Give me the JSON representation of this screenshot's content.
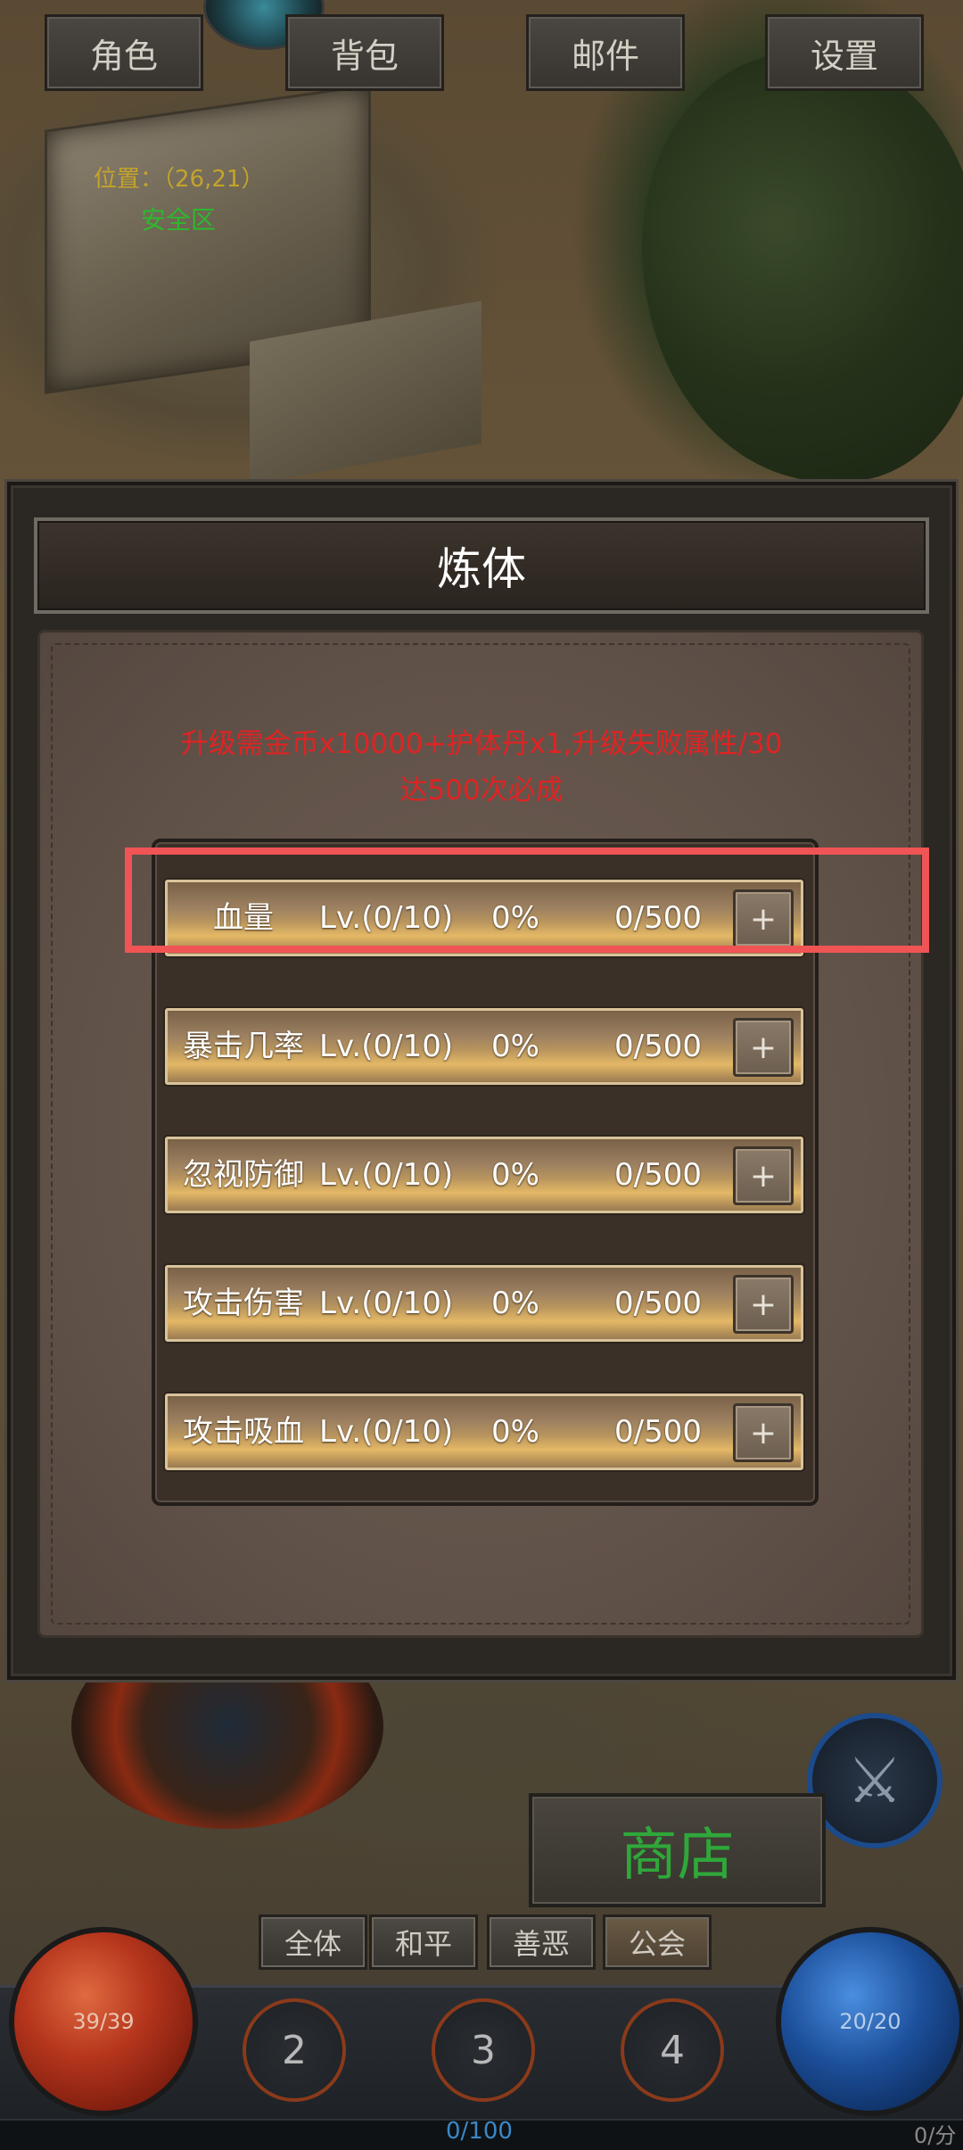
{
  "top_menu": {
    "character": "角色",
    "bag": "背包",
    "mail": "邮件",
    "settings": "设置"
  },
  "map": {
    "position": "位置：（26,21）",
    "zone": "安全区"
  },
  "modal": {
    "title": "炼体",
    "notice_line1": "升级需金币x10000+护体丹x1,升级失败属性/30",
    "notice_line2": "达500次必成",
    "attributes": [
      {
        "name": "血量",
        "level": "Lv.(0/10)",
        "percent": "0%",
        "progress": "0/500",
        "plus": "+"
      },
      {
        "name": "暴击几率",
        "level": "Lv.(0/10)",
        "percent": "0%",
        "progress": "0/500",
        "plus": "+"
      },
      {
        "name": "忽视防御",
        "level": "Lv.(0/10)",
        "percent": "0%",
        "progress": "0/500",
        "plus": "+"
      },
      {
        "name": "攻击伤害",
        "level": "Lv.(0/10)",
        "percent": "0%",
        "progress": "0/500",
        "plus": "+"
      },
      {
        "name": "攻击吸血",
        "level": "Lv.(0/10)",
        "percent": "0%",
        "progress": "0/500",
        "plus": "+"
      }
    ],
    "highlight_color": "#f05454"
  },
  "hud": {
    "shop": "商店",
    "chat_tabs": [
      "全体",
      "和平",
      "善恶",
      "公会"
    ],
    "hp": "39/39",
    "mp": "20/20",
    "skills": [
      "2",
      "3",
      "4"
    ],
    "xp": "0/100",
    "score": "0/分",
    "crossed_swords_icon": "⚔"
  },
  "colors": {
    "notice": "#e02323",
    "shop_text": "#2fa83a",
    "zone_text": "#2eb82e"
  }
}
